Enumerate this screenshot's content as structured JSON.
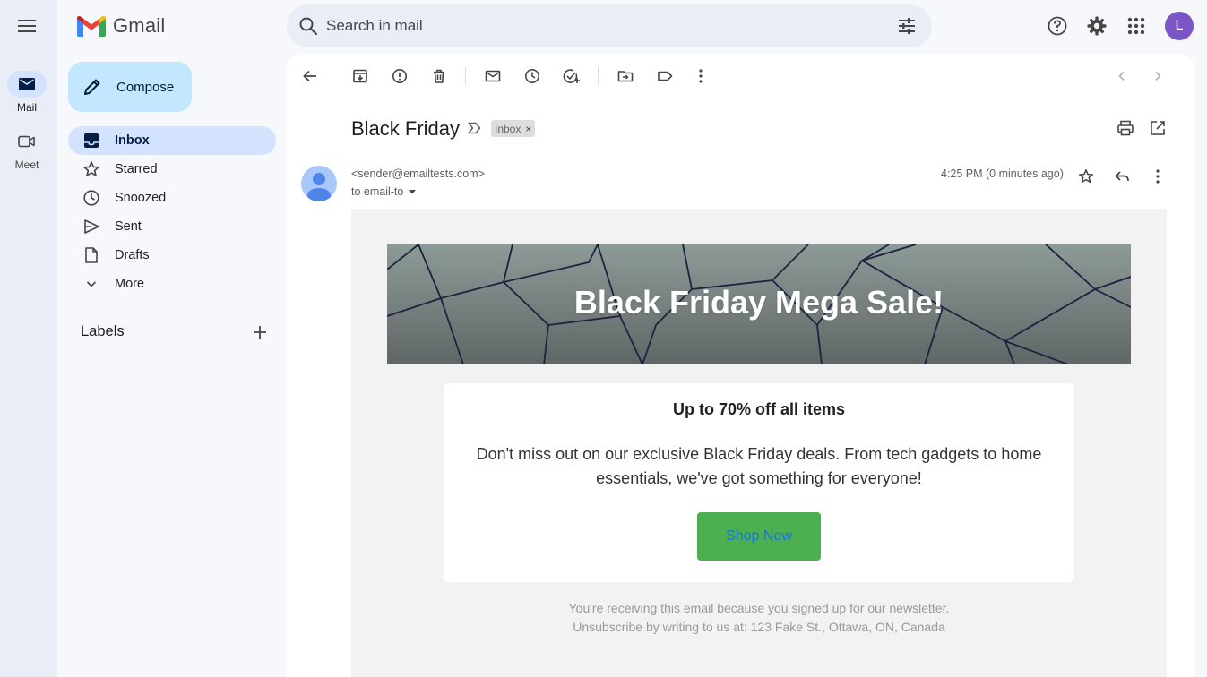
{
  "app": {
    "name": "Gmail"
  },
  "rail": {
    "items": [
      {
        "label": "Mail",
        "icon": "mail-icon",
        "active": true
      },
      {
        "label": "Meet",
        "icon": "video-icon",
        "active": false
      }
    ]
  },
  "search": {
    "placeholder": "Search in mail"
  },
  "user": {
    "avatar_letter": "L",
    "avatar_color": "#7b56c7"
  },
  "compose": {
    "label": "Compose"
  },
  "nav": {
    "items": [
      {
        "label": "Inbox",
        "icon": "inbox-icon",
        "active": true
      },
      {
        "label": "Starred",
        "icon": "star-icon"
      },
      {
        "label": "Snoozed",
        "icon": "clock-icon"
      },
      {
        "label": "Sent",
        "icon": "send-icon"
      },
      {
        "label": "Drafts",
        "icon": "draft-icon"
      },
      {
        "label": "More",
        "icon": "chevron-down-icon"
      }
    ],
    "labels_heading": "Labels"
  },
  "message": {
    "subject": "Black Friday",
    "label_chip": "Inbox",
    "chip_remove": "×",
    "sender": "<sender@emailtests.com>",
    "recipient": "to email-to",
    "time": "4:25 PM (0 minutes ago)"
  },
  "email": {
    "hero_title": "Black Friday Mega Sale!",
    "headline": "Up to 70% off all items",
    "body": "Don't miss out on our exclusive Black Friday deals. From tech gadgets to home essentials, we've got something for everyone!",
    "cta": "Shop Now",
    "cta_color": "#4caf50",
    "footer_line1": "You're receiving this email because you signed up for our newsletter.",
    "footer_line2": "Unsubscribe by writing to us at: 123 Fake St., Ottawa, ON, Canada"
  },
  "colors": {
    "accent": "#0b57d0",
    "nav_active_bg": "#d3e3fd",
    "compose_bg": "#c2e7ff"
  }
}
